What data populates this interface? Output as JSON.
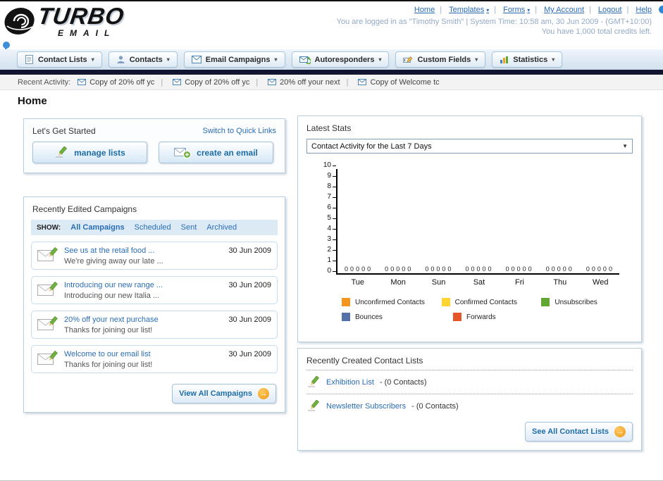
{
  "header": {
    "logo_title": "TURBO",
    "logo_subtitle": "EMAIL",
    "nav_links": [
      {
        "label": "Home"
      },
      {
        "label": "Templates"
      },
      {
        "label": "Forms"
      },
      {
        "label": "My Account"
      },
      {
        "label": "Logout"
      },
      {
        "label": "Help"
      }
    ],
    "login_line": "You are logged in as \"Timothy Smith\" | System Time: 10:58 am, 30 Jun 2009 - (GMT+10:00)",
    "credits_line": "You have 1,000 total credits left."
  },
  "nav_tabs": [
    {
      "label": "Contact Lists",
      "icon": "contact-lists-icon"
    },
    {
      "label": "Contacts",
      "icon": "contacts-icon"
    },
    {
      "label": "Email Campaigns",
      "icon": "email-campaigns-icon"
    },
    {
      "label": "Autoresponders",
      "icon": "autoresponders-icon"
    },
    {
      "label": "Custom Fields",
      "icon": "custom-fields-icon"
    },
    {
      "label": "Statistics",
      "icon": "statistics-icon"
    }
  ],
  "recent_activity": {
    "label": "Recent Activity:",
    "items": [
      "Copy of 20% off yc",
      "Copy of 20% off yc",
      "20% off your next",
      "Copy of Welcome tc"
    ]
  },
  "page": {
    "title": "Home"
  },
  "get_started": {
    "title": "Let's Get Started",
    "switch_link": "Switch to Quick Links",
    "buttons": [
      {
        "label": "manage lists"
      },
      {
        "label": "create an email"
      }
    ]
  },
  "campaigns": {
    "title": "Recently Edited Campaigns",
    "show_label": "SHOW:",
    "filters": [
      "All Campaigns",
      "Scheduled",
      "Sent",
      "Archived"
    ],
    "active_filter": "All Campaigns",
    "items": [
      {
        "title": "See us at the retail food ...",
        "subtitle": "We're giving away our late ...",
        "date": "30 Jun 2009"
      },
      {
        "title": "Introducing our new range ...",
        "subtitle": "Introducing our new Italia ...",
        "date": "30 Jun 2009"
      },
      {
        "title": "20% off your next purchase",
        "subtitle": "Thanks for joining our list!",
        "date": "30 Jun 2009"
      },
      {
        "title": "Welcome to our email list",
        "subtitle": "Thanks for joining our list!",
        "date": "30 Jun 2009"
      }
    ],
    "view_all_label": "View All Campaigns"
  },
  "latest_stats": {
    "title": "Latest Stats",
    "dropdown_value": "Contact Activity for the Last 7 Days",
    "chart_data": {
      "type": "bar",
      "categories": [
        "Tue",
        "Mon",
        "Sun",
        "Sat",
        "Fri",
        "Thu",
        "Wed"
      ],
      "series": [
        {
          "name": "Unconfirmed Contacts",
          "values": [
            0,
            0,
            0,
            0,
            0,
            0,
            0
          ]
        },
        {
          "name": "Confirmed Contacts",
          "values": [
            0,
            0,
            0,
            0,
            0,
            0,
            0
          ]
        },
        {
          "name": "Unsubscribes",
          "values": [
            0,
            0,
            0,
            0,
            0,
            0,
            0
          ]
        },
        {
          "name": "Bounces",
          "values": [
            0,
            0,
            0,
            0,
            0,
            0,
            0
          ]
        },
        {
          "name": "Forwards",
          "values": [
            0,
            0,
            0,
            0,
            0,
            0,
            0
          ]
        }
      ],
      "ylim": [
        0,
        10
      ],
      "yticks": [
        0,
        1,
        2,
        3,
        4,
        5,
        6,
        7,
        8,
        9,
        10
      ]
    },
    "legend": [
      {
        "label": "Unconfirmed Contacts",
        "color": "#F5941F"
      },
      {
        "label": "Confirmed Contacts",
        "color": "#FFD42E"
      },
      {
        "label": "Unsubscribes",
        "color": "#61A832"
      },
      {
        "label": "Bounces",
        "color": "#5472A8"
      },
      {
        "label": "Forwards",
        "color": "#E5562B"
      }
    ]
  },
  "contact_lists": {
    "title": "Recently Created Contact Lists",
    "items": [
      {
        "name": "Exhibition List",
        "detail": "- (0 Contacts)"
      },
      {
        "name": "Newsletter Subscribers",
        "detail": "- (0 Contacts)"
      }
    ],
    "see_all_label": "See All Contact Lists"
  },
  "theme": {
    "link_blue": "#2A6DB5",
    "button_text_blue": "#1D6DA9",
    "dark_bar": "#11152F",
    "accent_orange": "#EF9B13"
  }
}
